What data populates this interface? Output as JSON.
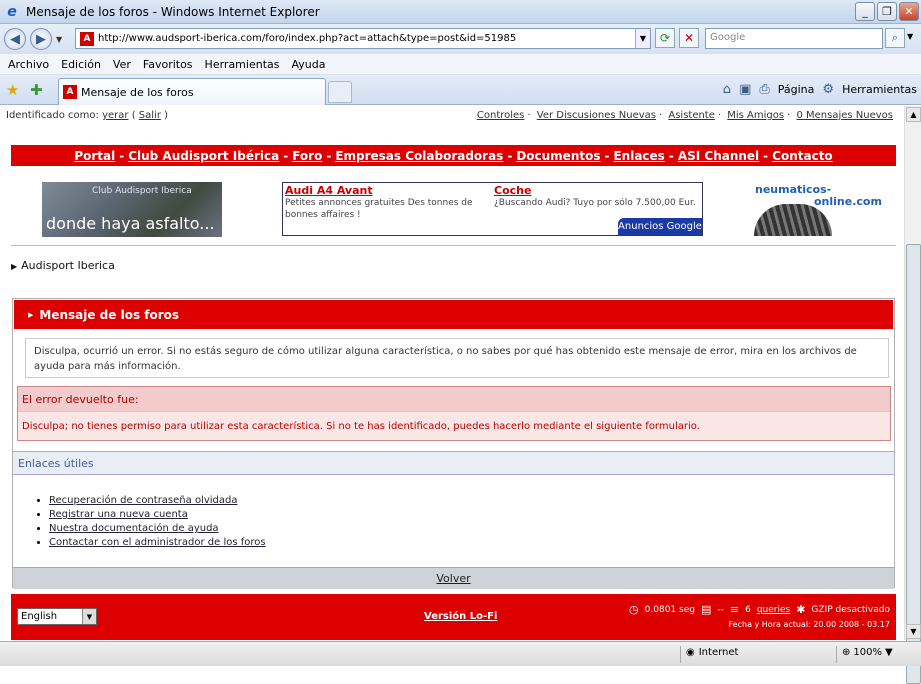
{
  "window": {
    "title": "Mensaje de los foros - Windows Internet Explorer",
    "minimize": "_",
    "restore": "❐",
    "close": "✕"
  },
  "toolbar": {
    "url": "http://www.audsport-iberica.com/foro/index.php?act=attach&type=post&id=51985",
    "search_placeholder": "Google"
  },
  "menu": [
    "Archivo",
    "Edición",
    "Ver",
    "Favoritos",
    "Herramientas",
    "Ayuda"
  ],
  "tab": {
    "label": "Mensaje de los foros"
  },
  "commandbar": {
    "page": "Página",
    "tools": "Herramientas"
  },
  "userbar": {
    "prefix": "Identificado como:",
    "user": "yerar",
    "logout": "Salir",
    "links": [
      "Controles",
      "Ver Discusiones Nuevas",
      "Asistente",
      "Mis Amigos",
      "0 Mensajes Nuevos"
    ]
  },
  "nav": [
    "Portal",
    "Club Audisport Ibérica",
    "Foro",
    "Empresas Colaboradoras",
    "Documentos",
    "Enlaces",
    "ASI Channel",
    "Contacto"
  ],
  "banner": {
    "small": "Club Audisport Iberica",
    "big": "donde haya asfalto..."
  },
  "ad": {
    "a1_title": "Audi A4 Avant",
    "a1_text": "Petites annonces gratuites Des tonnes de bonnes affaires !",
    "a2_title": "Coche",
    "a2_text": "¿Buscando Audi? Tuyo por sólo 7.500,00 Eur.",
    "badge": "Anuncios Google"
  },
  "neum": {
    "line1": "neumaticos-",
    "line2": "online.com"
  },
  "breadcrumb": "Audisport Iberica",
  "panel": {
    "title": "Mensaje de los foros",
    "message": "Disculpa, ocurrió un error. Si no estás seguro de cómo utilizar alguna característica, o no sabes por qué has obtenido este mensaje de error, mira en los archivos de ayuda para más información.",
    "error_head": "El error devuelto fue:",
    "error_text": "Disculpa; no tienes permiso para utilizar esta característica. Si no te has identificado, puedes hacerlo mediante el siguiente formulario.",
    "links_head": "Enlaces útiles",
    "links": [
      "Recuperación de contraseña olvidada",
      "Registrar una nueva cuenta",
      "Nuestra documentación de ayuda",
      "Contactar con el administrador de los foros"
    ],
    "back": "Volver"
  },
  "footer": {
    "language": "English",
    "lofi": "Versión Lo-Fi",
    "time": "0.0801 seg",
    "dash": "--",
    "queries_n": "6",
    "queries": "queries",
    "gzip": "GZIP desactivado",
    "fecha": "Fecha y Hora actual: 20.00 2008 - 03.17"
  },
  "status": {
    "zone": "Internet",
    "zoom": "100%"
  }
}
